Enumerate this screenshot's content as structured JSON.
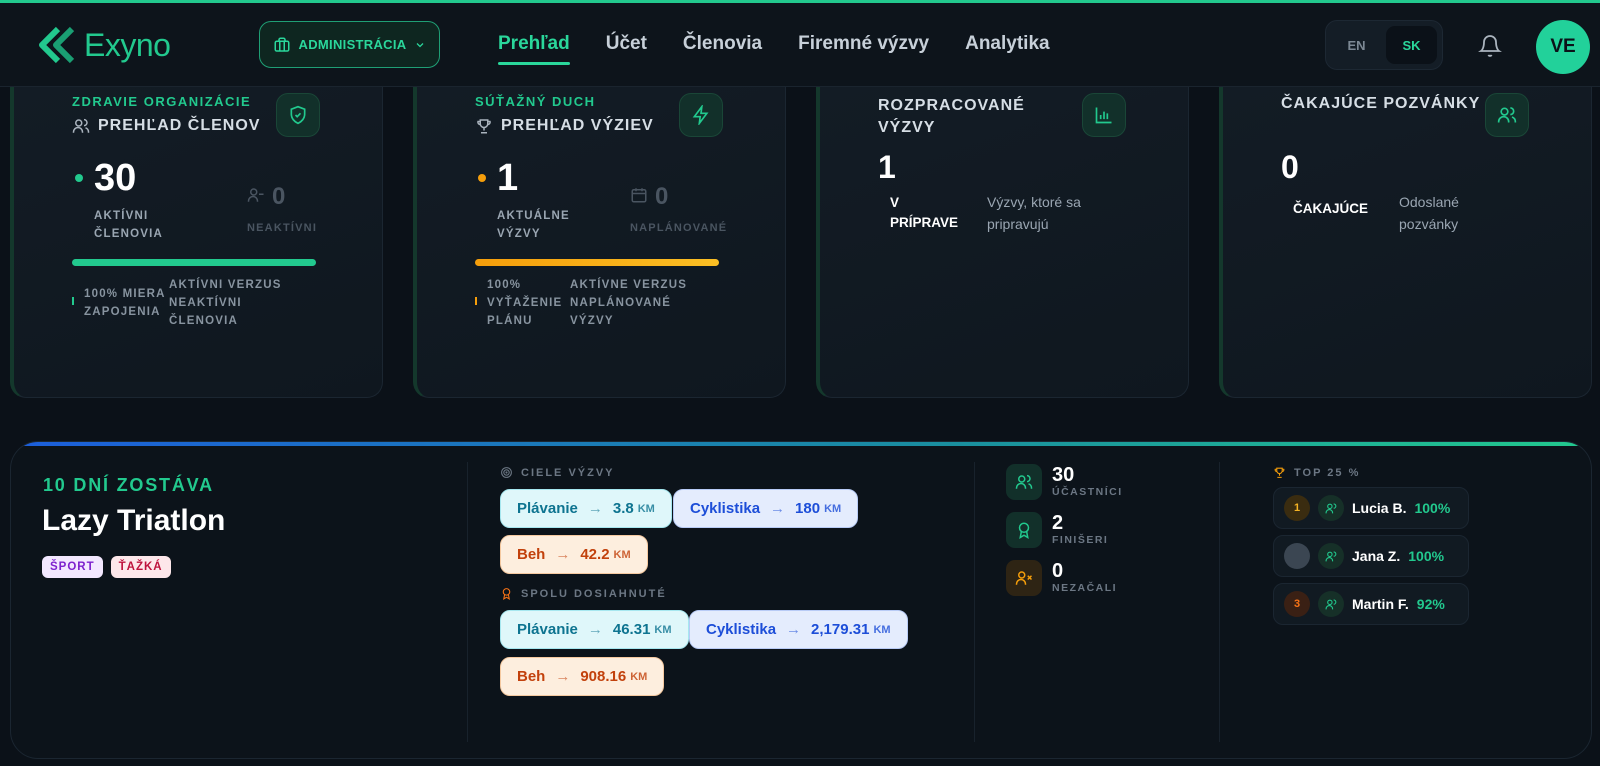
{
  "brand": {
    "name": "Exyno"
  },
  "header": {
    "admin_label": "ADMINISTRÁCIA",
    "nav": [
      {
        "label": "Prehľad",
        "active": true
      },
      {
        "label": "Účet",
        "active": false
      },
      {
        "label": "Členovia",
        "active": false
      },
      {
        "label": "Firemné výzvy",
        "active": false
      },
      {
        "label": "Analytika",
        "active": false
      }
    ],
    "languages": [
      "EN",
      "SK"
    ],
    "active_language": "SK",
    "avatar_initials": "VE"
  },
  "cards": {
    "members": {
      "eyebrow": "ZDRAVIE ORGANIZÁCIE",
      "title": "PREHĽAD ČLENOV",
      "active_value": "30",
      "active_label_1": "AKTÍVNI",
      "active_label_2": "ČLENOVIA",
      "inactive_value": "0",
      "inactive_label": "NEAKTÍVNI",
      "progress": 1.0,
      "foot_left_1": "100% MIERA",
      "foot_left_2": "ZAPOJENIA",
      "foot_right_1": "AKTÍVNI VERZUS",
      "foot_right_2": "NEAKTÍVNI",
      "foot_right_3": "ČLENOVIA"
    },
    "challenges": {
      "eyebrow": "SÚŤAŽNÝ DUCH",
      "title": "PREHĽAD VÝZIEV",
      "current_value": "1",
      "current_label_1": "AKTUÁLNE",
      "current_label_2": "VÝZVY",
      "planned_value": "0",
      "planned_label": "NAPLÁNOVANÉ",
      "progress": 1.0,
      "foot_left_1": "100%",
      "foot_left_2": "VYŤAŽENIE",
      "foot_left_3": "PLÁNU",
      "foot_right_1": "AKTÍVNE VERZUS",
      "foot_right_2": "NAPLÁNOVANÉ",
      "foot_right_3": "VÝZVY"
    },
    "in_progress": {
      "title_1": "ROZPRACOVANÉ",
      "title_2": "VÝZVY",
      "value": "1",
      "label_1": "V",
      "label_2": "PRÍPRAVE",
      "desc_1": "Výzvy, ktoré sa",
      "desc_2": "pripravujú"
    },
    "invites": {
      "title": "ČAKAJÚCE POZVÁNKY",
      "value": "0",
      "label": "ČAKAJÚCE",
      "desc_1": "Odoslané",
      "desc_2": "pozvánky"
    }
  },
  "challenge": {
    "days_left": "10 DNÍ ZOSTÁVA",
    "title": "Lazy Triatlon",
    "tags": [
      "ŠPORT",
      "ŤAŽKÁ"
    ],
    "goals_label": "CIELE VÝZVY",
    "goals": [
      {
        "name": "Plávanie",
        "value": "3.8",
        "unit": "KM"
      },
      {
        "name": "Cyklistika",
        "value": "180",
        "unit": "KM"
      },
      {
        "name": "Beh",
        "value": "42.2",
        "unit": "KM"
      }
    ],
    "achieved_label": "SPOLU DOSIAHNUTÉ",
    "achieved": [
      {
        "name": "Plávanie",
        "value": "46.31",
        "unit": "KM"
      },
      {
        "name": "Cyklistika",
        "value": "2,179.31",
        "unit": "KM"
      },
      {
        "name": "Beh",
        "value": "908.16",
        "unit": "KM"
      }
    ],
    "stats": [
      {
        "value": "30",
        "label": "ÚČASTNÍCI"
      },
      {
        "value": "2",
        "label": "FINIŠERI"
      },
      {
        "value": "0",
        "label": "NEZAČALI"
      }
    ],
    "top_label": "TOP 25 %",
    "leaderboard": [
      {
        "rank": "1",
        "name": "Lucia B.",
        "pct": "100%"
      },
      {
        "rank": "",
        "name": "Jana Z.",
        "pct": "100%"
      },
      {
        "rank": "3",
        "name": "Martin F.",
        "pct": "92%"
      }
    ]
  },
  "colors": {
    "accent": "#22c98e",
    "background": "#0b1118",
    "orange": "#f59e0b"
  }
}
